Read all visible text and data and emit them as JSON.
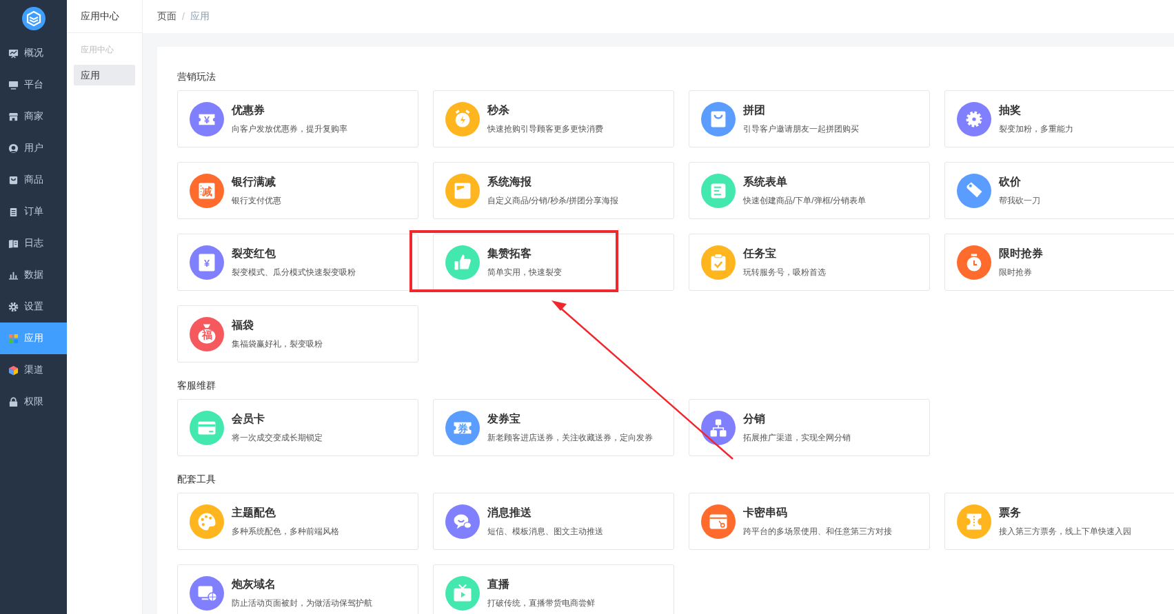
{
  "sidebar": {
    "items": [
      {
        "label": "概况",
        "selected": false
      },
      {
        "label": "平台",
        "selected": false
      },
      {
        "label": "商家",
        "selected": false
      },
      {
        "label": "用户",
        "selected": false
      },
      {
        "label": "商品",
        "selected": false
      },
      {
        "label": "订单",
        "selected": false
      },
      {
        "label": "日志",
        "selected": false
      },
      {
        "label": "数据",
        "selected": false
      },
      {
        "label": "设置",
        "selected": false
      },
      {
        "label": "应用",
        "selected": true
      },
      {
        "label": "渠道",
        "selected": false
      },
      {
        "label": "权限",
        "selected": false
      }
    ]
  },
  "submenu": {
    "title": "应用中心",
    "group_label": "应用中心",
    "items": [
      {
        "label": "应用",
        "selected": true
      }
    ]
  },
  "breadcrumb": {
    "items": [
      "页面",
      "应用"
    ],
    "separator": "/"
  },
  "sections": [
    {
      "title": "营销玩法",
      "apps": [
        {
          "name": "优惠券",
          "desc": "向客户发放优惠券，提升复购率",
          "color": "#8080ff",
          "icon_text": "¥"
        },
        {
          "name": "秒杀",
          "desc": "快速抢购引导顾客更多更快消费",
          "color": "#ffb61e"
        },
        {
          "name": "拼团",
          "desc": "引导客户邀请朋友一起拼团购买",
          "color": "#5b9cff"
        },
        {
          "name": "抽奖",
          "desc": "裂变加粉，多重能力",
          "color": "#8080ff"
        },
        {
          "name": "银行满减",
          "desc": "银行支付优惠",
          "color": "#ff6b2d",
          "icon_text": "减"
        },
        {
          "name": "系统海报",
          "desc": "自定义商品/分销/秒杀/拼团分享海报",
          "color": "#ffb61e"
        },
        {
          "name": "系统表单",
          "desc": "快速创建商品/下单/弹框/分销表单",
          "color": "#43e8ae"
        },
        {
          "name": "砍价",
          "desc": "帮我砍一刀",
          "color": "#5b9cff"
        },
        {
          "name": "裂变红包",
          "desc": "裂变模式、瓜分模式快速裂变吸粉",
          "color": "#8080ff",
          "icon_text": "¥"
        },
        {
          "name": "集赞拓客",
          "desc": "简单实用，快速裂变",
          "color": "#43e8ae"
        },
        {
          "name": "任务宝",
          "desc": "玩转服务号，吸粉首选",
          "color": "#ffb61e"
        },
        {
          "name": "限时抢券",
          "desc": "限时抢券",
          "color": "#ff6b2d"
        },
        {
          "name": "福袋",
          "desc": "集福袋赢好礼，裂变吸粉",
          "color": "#f5595e",
          "icon_text": "福"
        }
      ]
    },
    {
      "title": "客服维群",
      "apps": [
        {
          "name": "会员卡",
          "desc": "将一次成交变成长期锁定",
          "color": "#43e8ae"
        },
        {
          "name": "发券宝",
          "desc": "新老顾客进店送券，关注收藏送券，定向发券",
          "color": "#5b9cff",
          "icon_text": "券"
        },
        {
          "name": "分销",
          "desc": "拓展推广渠道，实现全网分销",
          "color": "#8080ff"
        }
      ]
    },
    {
      "title": "配套工具",
      "apps": [
        {
          "name": "主题配色",
          "desc": "多种系统配色，多种前端风格",
          "color": "#ffb61e"
        },
        {
          "name": "消息推送",
          "desc": "短信、模板消息、图文主动推送",
          "color": "#8080ff"
        },
        {
          "name": "卡密串码",
          "desc": "跨平台的多场景使用、和任意第三方对接",
          "color": "#ff6b2d"
        },
        {
          "name": "票务",
          "desc": "接入第三方票务，线上下单快速入园",
          "color": "#ffb61e"
        },
        {
          "name": "炮灰域名",
          "desc": "防止活动页面被封，为做活动保驾护航",
          "color": "#8080ff"
        },
        {
          "name": "直播",
          "desc": "打破传统，直播带货电商尝鲜",
          "color": "#43e8ae"
        }
      ]
    }
  ]
}
